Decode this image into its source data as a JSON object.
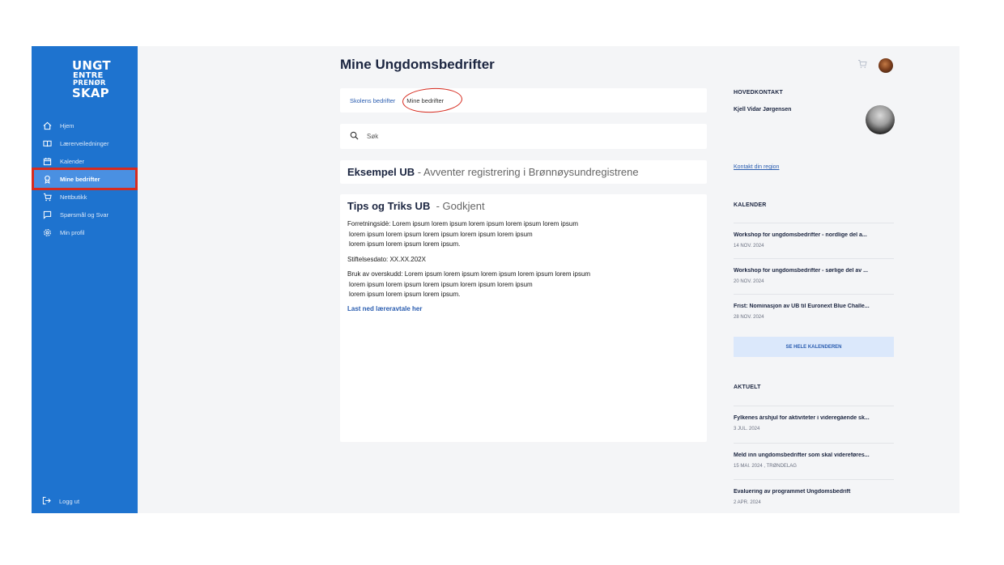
{
  "sidebar": {
    "logo": [
      "UNGT",
      "ENTRE",
      "PRENØR",
      "SKAP"
    ],
    "items": [
      {
        "label": "Hjem",
        "icon": "home-icon"
      },
      {
        "label": "Lærerveiledninger",
        "icon": "book-icon"
      },
      {
        "label": "Kalender",
        "icon": "calendar-icon"
      },
      {
        "label": "Mine bedrifter",
        "icon": "badge-icon",
        "active": true
      },
      {
        "label": "Nettbutikk",
        "icon": "cart-icon"
      },
      {
        "label": "Spørsmål og Svar",
        "icon": "chat-icon"
      },
      {
        "label": "Min profil",
        "icon": "gear-icon"
      }
    ],
    "logout": "Logg ut"
  },
  "main": {
    "title": "Mine Ungdomsbedrifter",
    "tabs": [
      "Skolens bedrifter",
      "Mine bedrifter"
    ],
    "search_placeholder": "Søk",
    "company1": {
      "name": "Eksempel UB",
      "status": "- Avventer registrering i Brønnøysundregistrene"
    },
    "company2": {
      "name": "Tips og Triks UB",
      "status": "- Godkjent",
      "forretningside_1": "Forretningsidè: Lorem ipsum lorem ipsum lorem ipsum lorem ipsum lorem ipsum",
      "forretningside_2": "lorem ipsum lorem ipsum lorem ipsum lorem ipsum lorem ipsum",
      "forretningside_3": "lorem ipsum lorem ipsum lorem ipsum.",
      "stiftelsesdato": "Stiftelsesdato: XX.XX.202X",
      "overskudd_1": "Bruk av overskudd: Lorem ipsum lorem ipsum lorem ipsum lorem ipsum lorem ipsum",
      "overskudd_2": "lorem ipsum lorem ipsum lorem ipsum lorem ipsum lorem ipsum",
      "overskudd_3": "lorem ipsum lorem ipsum lorem ipsum.",
      "download_link": "Last ned læreravtale her"
    }
  },
  "right": {
    "contact_label": "HOVEDKONTAKT",
    "contact_name": "Kjell Vidar Jørgensen",
    "region_link": "Kontakt din region",
    "calendar_label": "KALENDER",
    "events": [
      {
        "title": "Workshop for ungdomsbedrifter - nordlige del a...",
        "date": "14 NOV. 2024"
      },
      {
        "title": "Workshop for ungdomsbedrifter - sørlige del av ...",
        "date": "20 NOV. 2024"
      },
      {
        "title": "Frist: Nominasjon av UB til Euronext Blue Challe...",
        "date": "28 NOV. 2024"
      }
    ],
    "calendar_button": "SE HELE KALENDEREN",
    "news_label": "AKTUELT",
    "news": [
      {
        "title": "Fylkenes årshjul for aktiviteter i videregående sk...",
        "date": "3 JUL. 2024"
      },
      {
        "title": "Meld inn ungdomsbedrifter som skal videreføres...",
        "date": "15 MAI. 2024 , TRØNDELAG"
      },
      {
        "title": "Evaluering av programmet Ungdomsbedrift",
        "date": "2 APR. 2024"
      }
    ]
  }
}
